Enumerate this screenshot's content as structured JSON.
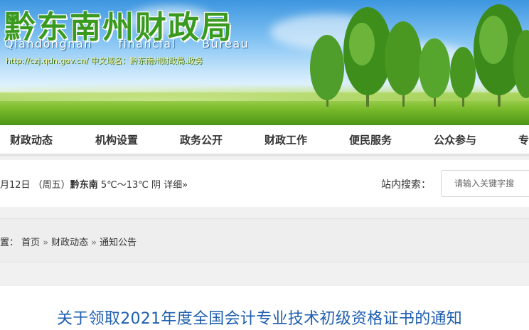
{
  "site": {
    "title": "黔东南州财政局",
    "subtitle": "Qiandongnan financial Bureau",
    "domain_text": "http://czj.qdn.gov.cn/ 中文域名：黔东南州财政局.政务"
  },
  "nav": {
    "items": [
      "财政动态",
      "机构设置",
      "政务公开",
      "财政工作",
      "便民服务",
      "公众参与",
      "专"
    ]
  },
  "info": {
    "date": "月12日 （周五）",
    "city": "黔东南",
    "weather": " 5℃～13℃ 阴 ",
    "detail": "详细»"
  },
  "search": {
    "label": "站内搜索：",
    "placeholder": "请输入关键字搜"
  },
  "breadcrumb": {
    "prefix": "置：",
    "items": [
      "首页",
      "财政动态",
      "通知公告"
    ],
    "separator": "»"
  },
  "article": {
    "title": "关于领取2021年度全国会计专业技术初级资格证书的通知"
  },
  "colors": {
    "brand_green": "#3a9a1f",
    "title_blue": "#1f5fb0"
  }
}
